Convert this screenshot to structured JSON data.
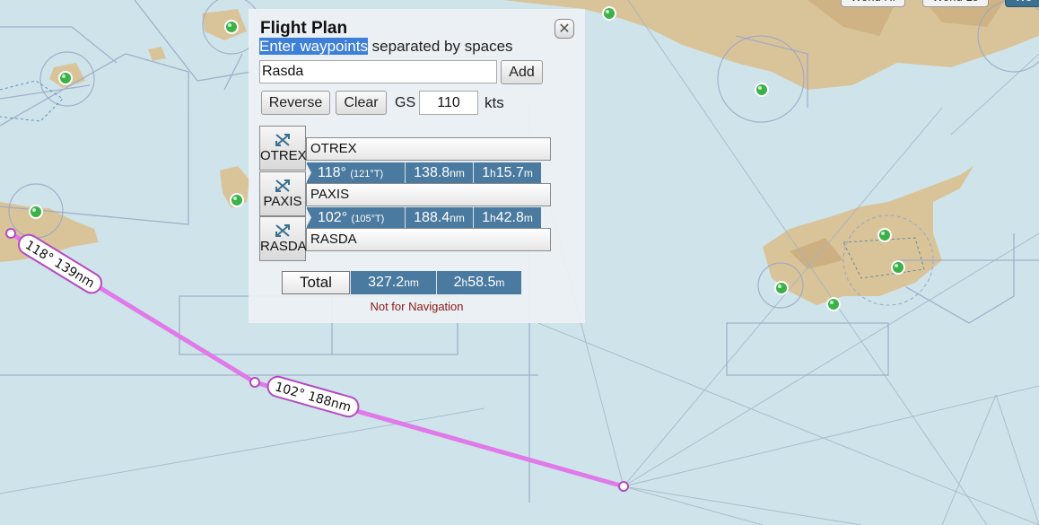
{
  "map_controls": {
    "layer_buttons": [
      "World Hi",
      "World Lo",
      "Wo"
    ]
  },
  "flight_plan": {
    "title": "Flight Plan",
    "close_icon": "close-x-icon",
    "instructions_highlight": "Enter waypoints",
    "instructions_rest": " separated by spaces",
    "waypoint_input_value": "Rasda",
    "add_label": "Add",
    "reverse_label": "Reverse",
    "clear_label": "Clear",
    "gs_label": "GS",
    "gs_value": "110",
    "gs_unit": "kts",
    "waypoint_icon": "fix-crossed-arrows-icon",
    "waypoints": [
      {
        "code": "OTREX",
        "name": "OTREX"
      },
      {
        "code": "PAXIS",
        "name": "PAXIS"
      },
      {
        "code": "RASDA",
        "name": "RASDA"
      }
    ],
    "legs": [
      {
        "heading": "118°",
        "true_heading": "(121°T)",
        "distance": "138.8",
        "distance_unit": "nm",
        "time_h": "1",
        "time_h_unit": "h",
        "time_m": "15.7",
        "time_m_unit": "m"
      },
      {
        "heading": "102°",
        "true_heading": "(105°T)",
        "distance": "188.4",
        "distance_unit": "nm",
        "time_h": "1",
        "time_h_unit": "h",
        "time_m": "42.8",
        "time_m_unit": "m"
      }
    ],
    "total_label": "Total",
    "total_distance": "327.2",
    "total_distance_unit": "nm",
    "total_time_h": "2",
    "total_time_h_unit": "h",
    "total_time_m": "58.5",
    "total_time_m_unit": "m",
    "footer_note": "Not for Navigation"
  },
  "route_labels": [
    "118° 139nm",
    "102° 188nm"
  ],
  "colors": {
    "sea": "#cfe4ea",
    "land": "#d9c49a",
    "route": "#e07ae9",
    "leg_cell": "#4a7aa0",
    "airport_marker": "#3cb14a",
    "note": "#8b1a1a"
  }
}
